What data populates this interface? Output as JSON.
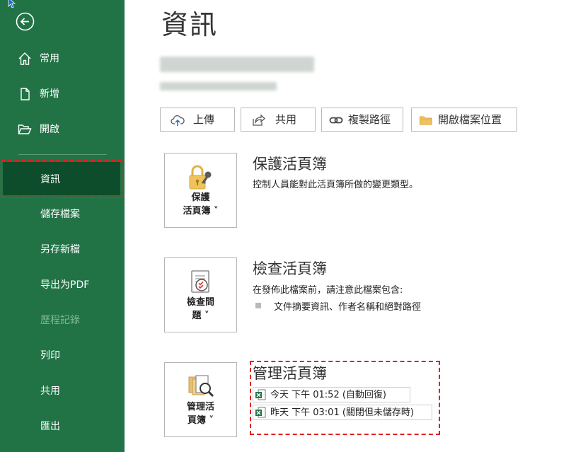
{
  "sidebar": {
    "items": [
      {
        "label": "常用",
        "icon": "home-icon"
      },
      {
        "label": "新增",
        "icon": "new-file-icon"
      },
      {
        "label": "開啟",
        "icon": "open-folder-icon"
      },
      {
        "label": "資訊"
      },
      {
        "label": "儲存檔案"
      },
      {
        "label": "另存新檔"
      },
      {
        "label": "导出为PDF"
      },
      {
        "label": "歷程記錄"
      },
      {
        "label": "列印"
      },
      {
        "label": "共用"
      },
      {
        "label": "匯出"
      }
    ]
  },
  "page": {
    "title": "資訊"
  },
  "actions": {
    "upload": "上傳",
    "share": "共用",
    "copy_path": "複製路徑",
    "open_location": "開啟檔案位置"
  },
  "protect": {
    "tile_line1": "保護",
    "tile_line2": "活頁簿 ˅",
    "title": "保護活頁簿",
    "desc": "控制人員能對此活頁簿所做的變更類型。"
  },
  "inspect": {
    "tile_line1": "檢查問",
    "tile_line2": "題 ˅",
    "title": "檢查活頁簿",
    "desc": "在發佈此檔案前，請注意此檔案包含:",
    "bullet": "文件摘要資訊、作者名稱和絕對路徑"
  },
  "manage": {
    "tile_line1": "管理活",
    "tile_line2": "頁簿 ˅",
    "title": "管理活頁簿",
    "versions": [
      {
        "label": "今天 下午 01:52 (自動回復)"
      },
      {
        "label": "昨天 下午 03:01 (關閉但未儲存時)"
      }
    ]
  },
  "colors": {
    "sidebar": "#217346",
    "sidebar_active": "#0e4d2b",
    "highlight": "#e02020"
  }
}
